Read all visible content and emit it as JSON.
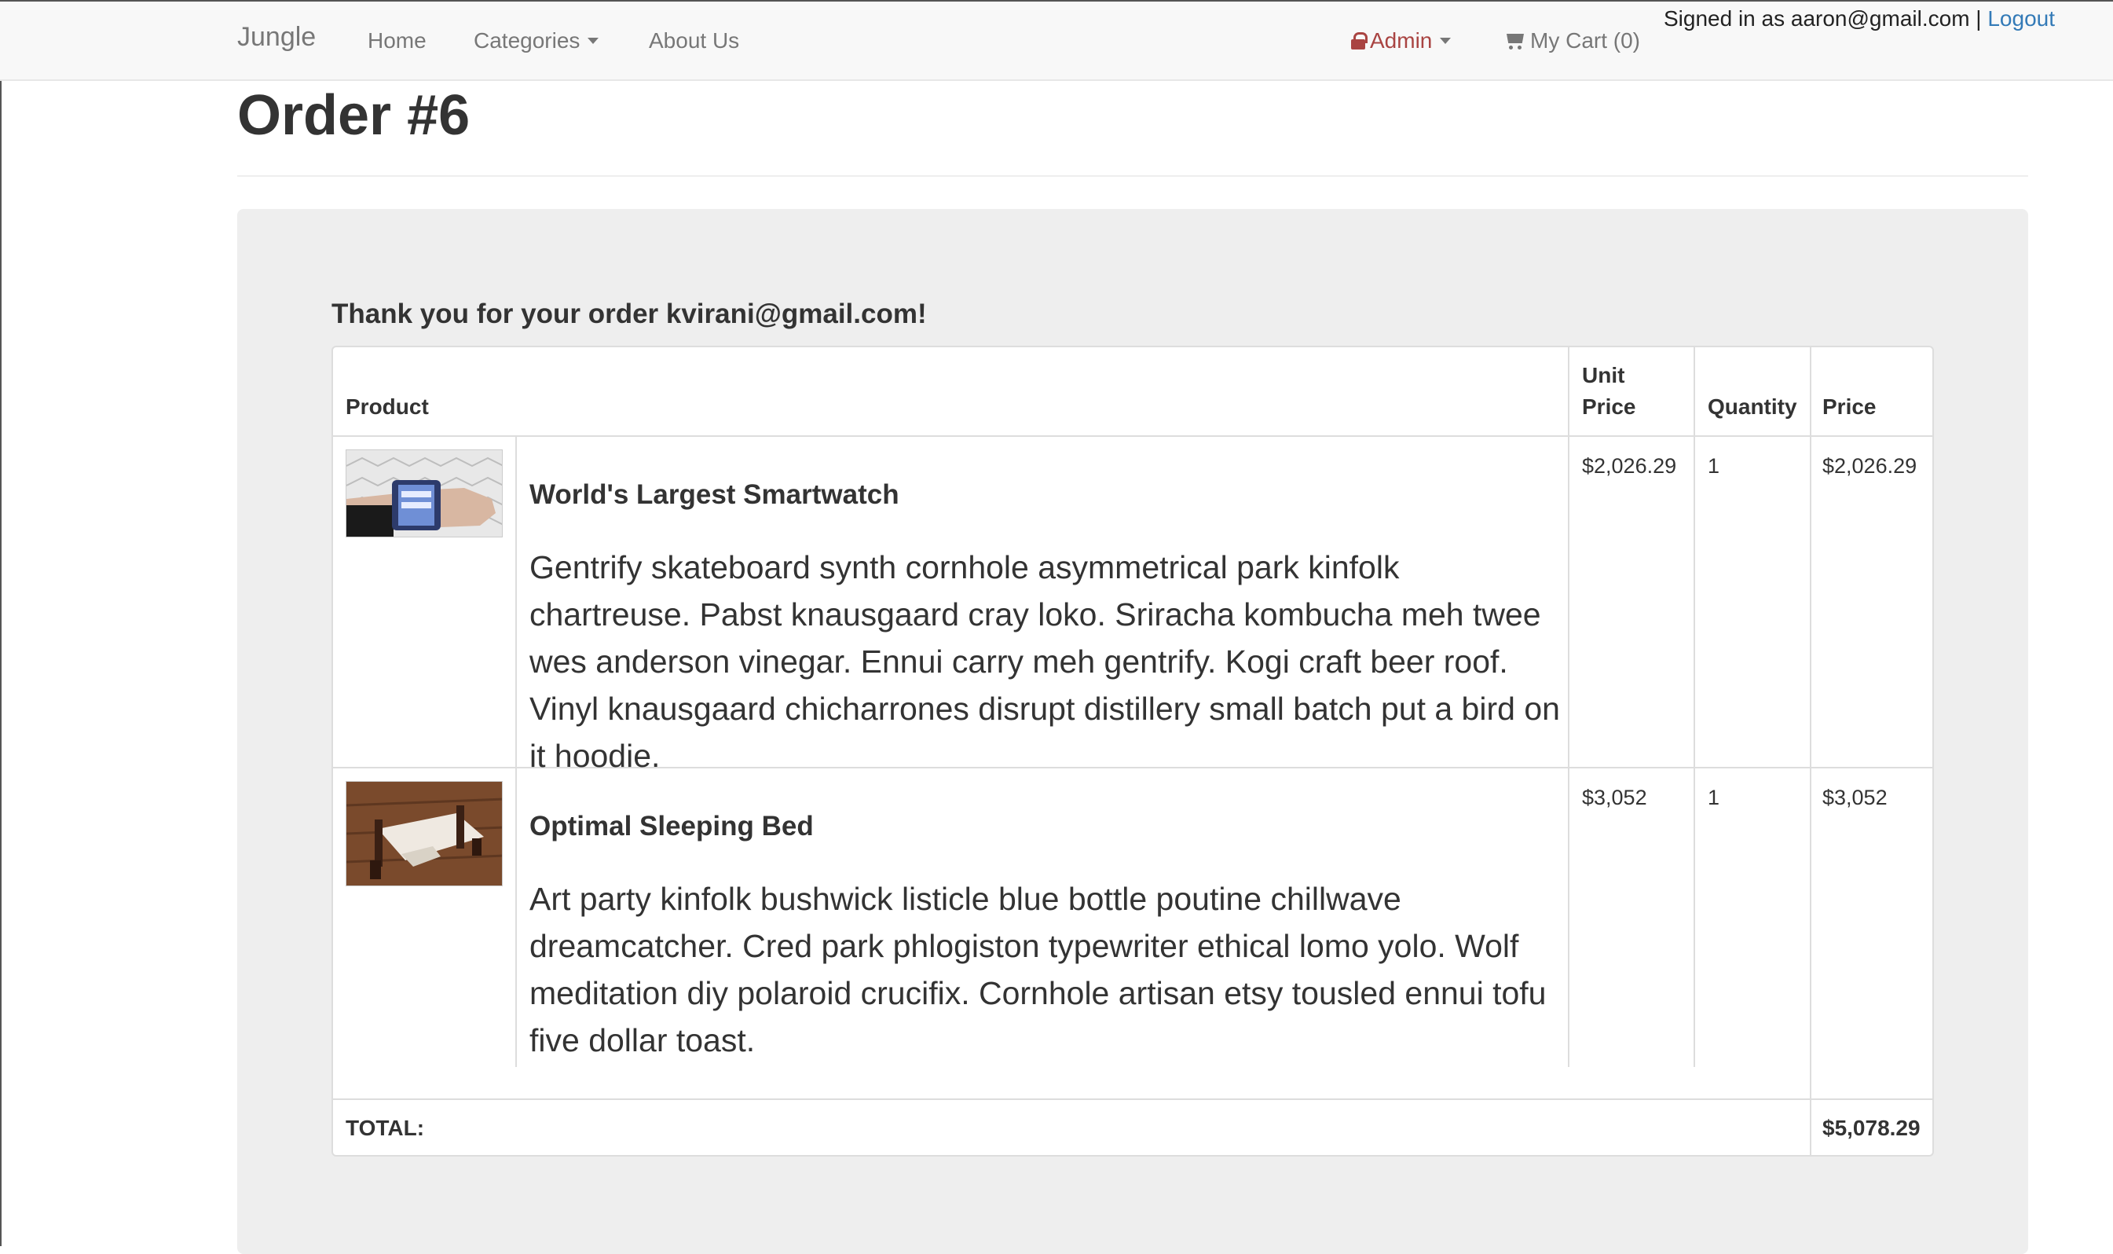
{
  "nav": {
    "brand": "Jungle",
    "home": "Home",
    "categories": "Categories",
    "about": "About Us",
    "admin": "Admin",
    "cart": "My Cart (0)",
    "signed_in_text": "Signed in as aaron@gmail.com |",
    "logout": "Logout"
  },
  "page": {
    "title": "Order #6",
    "thanks": "Thank you for your order kvirani@gmail.com!"
  },
  "table": {
    "headers": {
      "product": "Product",
      "unit_price_line1": "Unit",
      "unit_price_line2": "Price",
      "quantity": "Quantity",
      "price": "Price"
    },
    "rows": [
      {
        "name": "World's Largest Smartwatch",
        "description": "Gentrify skateboard synth cornhole asymmetrical park kinfolk chartreuse. Pabst knausgaard cray loko. Sriracha kombucha meh twee wes anderson vinegar. Ennui carry meh gentrify. Kogi craft beer roof. Vinyl knausgaard chicharrones disrupt distillery small batch put a bird on it hoodie.",
        "unit_price": "$2,026.29",
        "quantity": "1",
        "price": "$2,026.29"
      },
      {
        "name": "Optimal Sleeping Bed",
        "description": "Art party kinfolk bushwick listicle blue bottle poutine chillwave dreamcatcher. Cred park phlogiston typewriter ethical lomo yolo. Wolf meditation diy polaroid crucifix. Cornhole artisan etsy tousled ennui tofu five dollar toast.",
        "unit_price": "$3,052",
        "quantity": "1",
        "price": "$3,052"
      }
    ],
    "total_label": "TOTAL:",
    "total_value": "$5,078.29"
  },
  "colors": {
    "admin": "#a94442",
    "link": "#337ab7",
    "well": "#eeeeee"
  }
}
